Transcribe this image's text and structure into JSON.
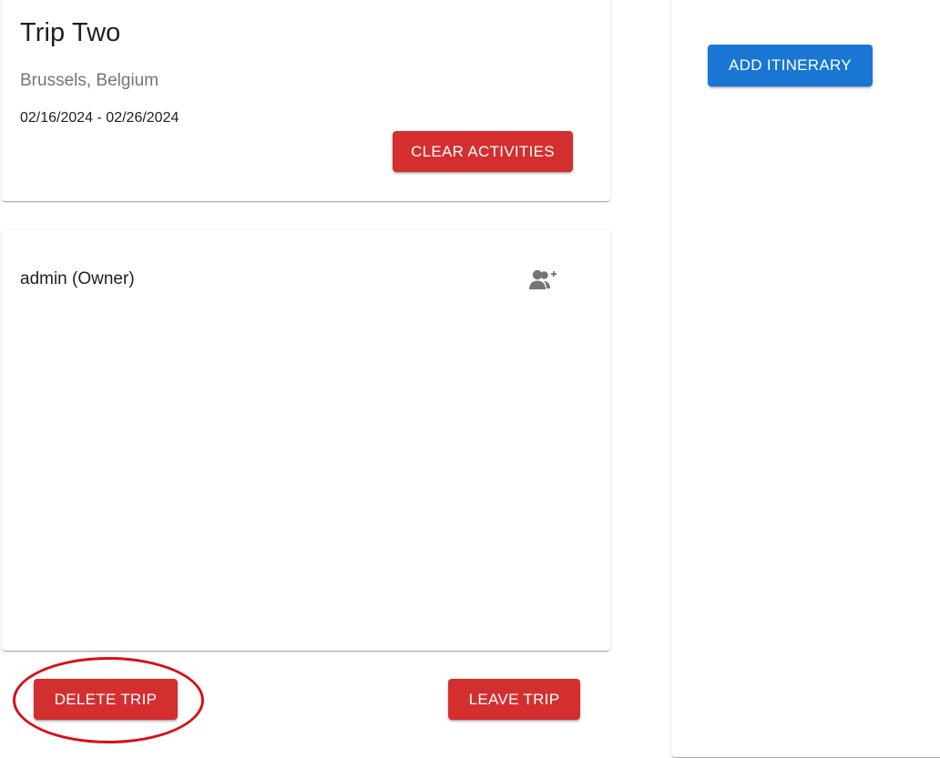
{
  "trip": {
    "title": "Trip Two",
    "location": "Brussels, Belgium",
    "date_range": "02/16/2024 - 02/26/2024",
    "clear_activities_label": "CLEAR ACTIVITIES"
  },
  "members": {
    "items": [
      {
        "label": "admin (Owner)"
      }
    ],
    "add_member_icon": "person-add-icon"
  },
  "actions": {
    "delete_trip_label": "DELETE TRIP",
    "leave_trip_label": "LEAVE TRIP"
  },
  "itinerary": {
    "add_itinerary_label": "ADD ITINERARY"
  },
  "colors": {
    "danger": "#d32f2f",
    "primary": "#1976d2",
    "annotation": "#d80f1a"
  }
}
